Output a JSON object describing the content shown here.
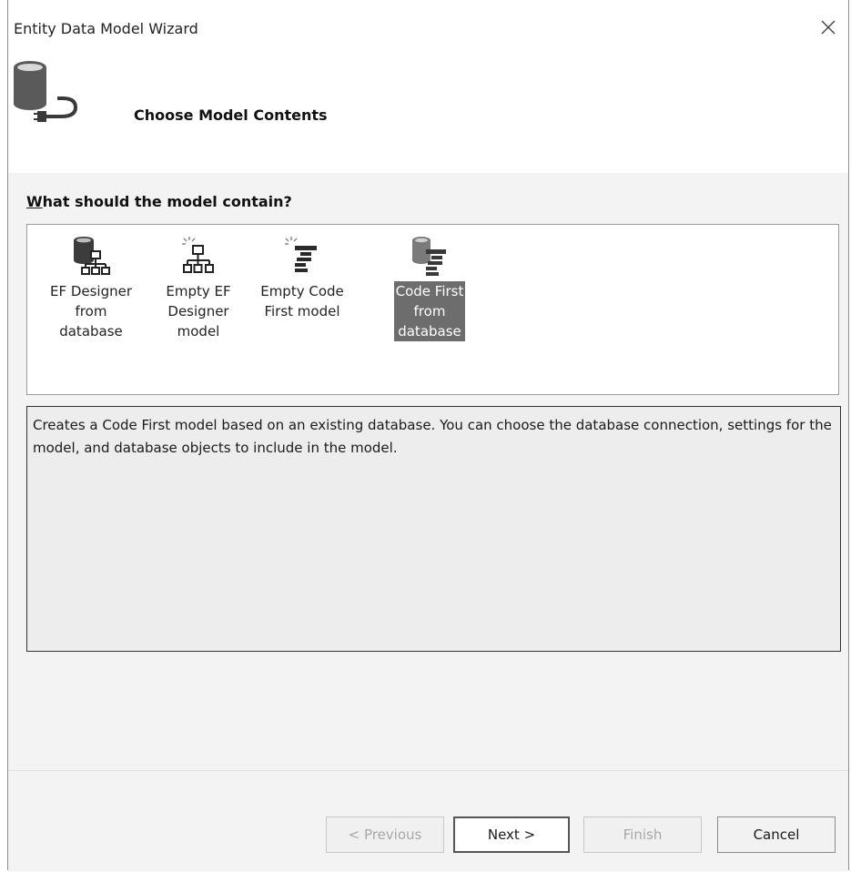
{
  "window": {
    "title": "Entity Data Model Wizard",
    "close_glyph": "✕"
  },
  "header": {
    "icon": "database-connector-icon",
    "heading": "Choose Model Contents"
  },
  "content": {
    "question_first_letter": "W",
    "question_rest": "hat should the model contain?",
    "options": [
      {
        "label": "EF Designer\nfrom\ndatabase",
        "icon": "database-hierarchy-icon",
        "selected": false
      },
      {
        "label": "Empty EF\nDesigner\nmodel",
        "icon": "hierarchy-sparkle-icon",
        "selected": false
      },
      {
        "label": "Empty Code\nFirst model",
        "icon": "code-sparkle-icon",
        "selected": false
      },
      {
        "label": "Code First\nfrom\ndatabase",
        "icon": "database-code-icon",
        "selected": true
      }
    ],
    "description": "Creates a Code First model based on an existing database. You can choose the database connection, settings for the model, and database objects to include in the model."
  },
  "buttons": {
    "previous": "< Previous",
    "next": "Next >",
    "finish": "Finish",
    "cancel": "Cancel"
  },
  "colors": {
    "selected_bg": "#6d6d6d",
    "content_bg": "#f3f3f3"
  }
}
